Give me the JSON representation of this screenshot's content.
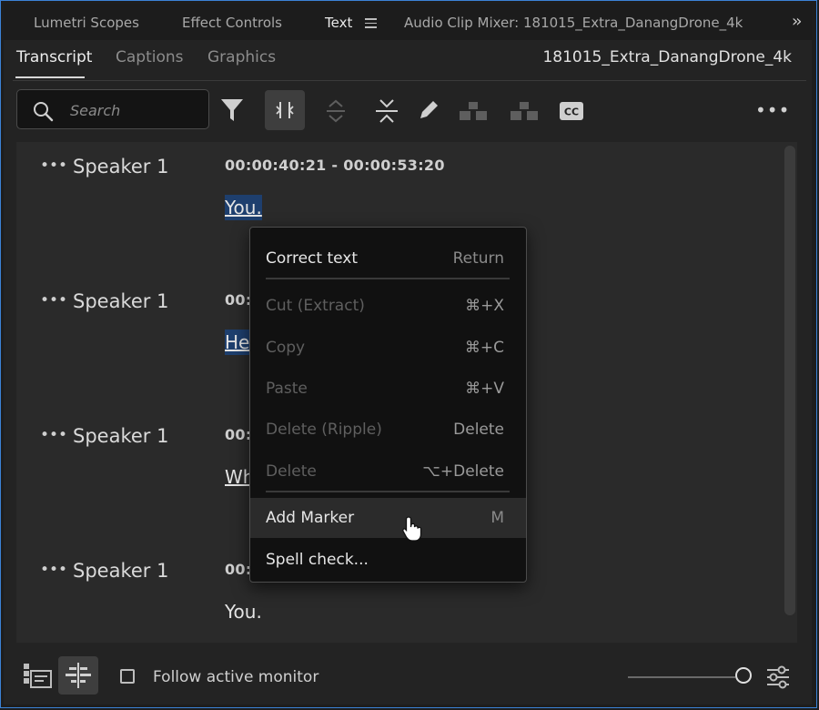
{
  "panel_tabs": [
    {
      "label": "Lumetri Scopes"
    },
    {
      "label": "Effect Controls"
    },
    {
      "label": "Text"
    },
    {
      "label": "Audio Clip Mixer: 181015_Extra_DanangDrone_4k"
    }
  ],
  "sub_tabs": [
    {
      "label": "Transcript"
    },
    {
      "label": "Captions"
    },
    {
      "label": "Graphics"
    }
  ],
  "clip_name": "181015_Extra_DanangDrone_4k",
  "search": {
    "placeholder": "Search"
  },
  "transcript": [
    {
      "speaker": "Speaker 1",
      "time": "00:00:40:21 - 00:00:53:20",
      "text": "You."
    },
    {
      "speaker": "Speaker 1",
      "time": "00:",
      "text": "He"
    },
    {
      "speaker": "Speaker 1",
      "time": "00:",
      "text": "Wh"
    },
    {
      "speaker": "Speaker 1",
      "time": "00:",
      "text": "You."
    }
  ],
  "context_menu": [
    {
      "label": "Correct text",
      "shortcut": "Return"
    },
    {
      "label": "Cut (Extract)",
      "shortcut": "⌘+X"
    },
    {
      "label": "Copy",
      "shortcut": "⌘+C"
    },
    {
      "label": "Paste",
      "shortcut": "⌘+V"
    },
    {
      "label": "Delete (Ripple)",
      "shortcut": "Delete"
    },
    {
      "label": "Delete",
      "shortcut": "⌥+Delete"
    },
    {
      "label": "Add Marker",
      "shortcut": "M"
    },
    {
      "label": "Spell check..."
    }
  ],
  "footer": {
    "follow_label": "Follow active monitor"
  },
  "icons": {
    "search": "search-icon",
    "filter": "filter-icon",
    "split": "split-segment-icon",
    "expand": "expand-icon",
    "collapse": "collapse-icon",
    "edit": "pencil-icon",
    "merge": "merge-icon",
    "speakers": "speakers-icon",
    "cc": "cc-icon",
    "more": "more-icon",
    "create-sequence": "create-sequence-icon",
    "align": "align-icon",
    "settings": "settings-icon"
  }
}
